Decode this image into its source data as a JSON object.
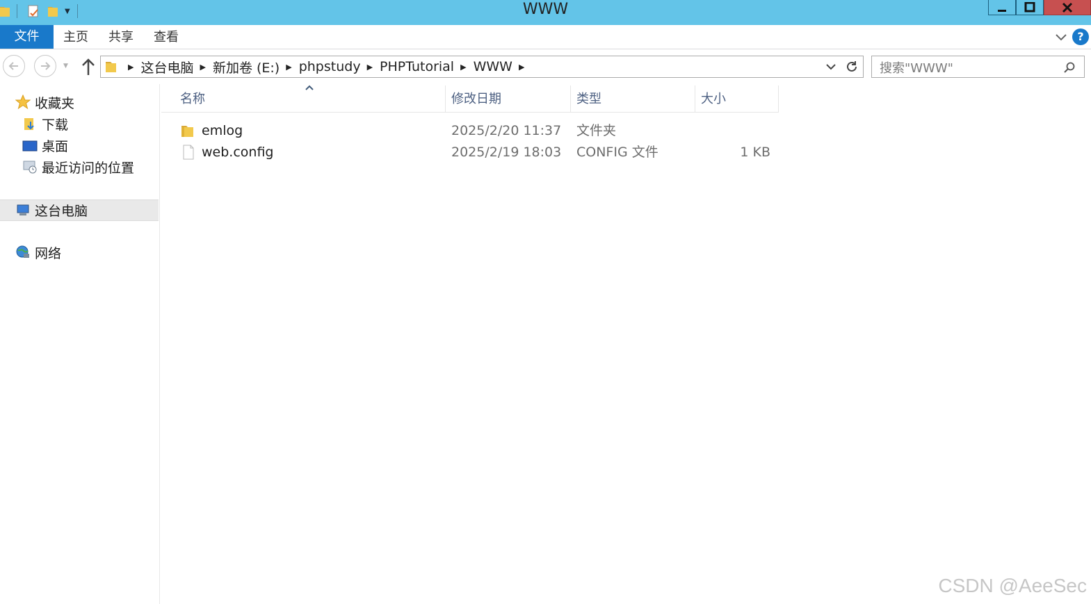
{
  "window": {
    "title": "WWW"
  },
  "ribbon": {
    "tabs": [
      {
        "label": "文件"
      },
      {
        "label": "主页"
      },
      {
        "label": "共享"
      },
      {
        "label": "查看"
      }
    ],
    "help_label": "?"
  },
  "address": {
    "crumbs": [
      "这台电脑",
      "新加卷 (E:)",
      "phpstudy",
      "PHPTutorial",
      "WWW"
    ]
  },
  "search": {
    "placeholder": "搜索\"WWW\""
  },
  "nav": {
    "favorites": "收藏夹",
    "downloads": "下载",
    "desktop": "桌面",
    "recent": "最近访问的位置",
    "this_pc": "这台电脑",
    "network": "网络"
  },
  "columns": {
    "name": "名称",
    "modified": "修改日期",
    "type": "类型",
    "size": "大小"
  },
  "files": [
    {
      "name": "emlog",
      "modified": "2025/2/20 11:37",
      "type": "文件夹",
      "size": "",
      "icon": "folder-icon"
    },
    {
      "name": "web.config",
      "modified": "2025/2/19 18:03",
      "type": "CONFIG 文件",
      "size": "1 KB",
      "icon": "file-icon"
    }
  ],
  "watermark": "CSDN @AeeSec",
  "colors": {
    "titlebar": "#63c4e8",
    "file_tab": "#1979ca",
    "close_button": "#c75050"
  }
}
